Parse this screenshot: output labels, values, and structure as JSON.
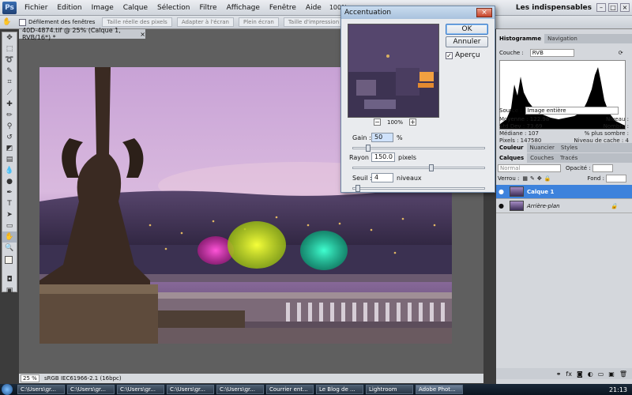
{
  "menubar": {
    "logo": "Ps",
    "items": [
      "Fichier",
      "Edition",
      "Image",
      "Calque",
      "Sélection",
      "Filtre",
      "Affichage",
      "Fenêtre",
      "Aide"
    ],
    "zoom_value": "100%",
    "workspace": "Les indispensables"
  },
  "optbar": {
    "scroll_all_label": "Défilement des fenêtres",
    "buttons": [
      "Taille réelle des pixels",
      "Adapter à l'écran",
      "Plein écran",
      "Taille d'impression"
    ]
  },
  "document": {
    "tab_title": "40D-4874.tif @ 25% (Calque 1, RVB/16*) *",
    "zoom": "25 %",
    "profile": "sRGB IEC61966-2.1 (16bpc)"
  },
  "dialog": {
    "title": "Accentuation",
    "ok": "OK",
    "cancel": "Annuler",
    "preview_label": "Aperçu",
    "preview_checked": true,
    "zoom": "100%",
    "gain_label": "Gain :",
    "gain_value": "50",
    "gain_unit": "%",
    "gain_level": 0.1,
    "rayon_label": "Rayon :",
    "rayon_value": "150.0",
    "rayon_unit": "pixels",
    "rayon_level": 0.6,
    "seuil_label": "Seuil :",
    "seuil_value": "4",
    "seuil_unit": "niveaux",
    "seuil_level": 0.02
  },
  "panels": {
    "top_tabs": [
      "Histogramme",
      "Navigation"
    ],
    "couche_label": "Couche :",
    "couche_value": "RVB",
    "source_label": "Source :",
    "source_value": "Image entière",
    "stats_left": [
      {
        "label": "Moyenne :",
        "value": "122.98"
      },
      {
        "label": "Std Dev :",
        "value": "73.69"
      },
      {
        "label": "Médiane :",
        "value": "107"
      },
      {
        "label": "Pixels :",
        "value": "147580"
      }
    ],
    "stats_right": [
      {
        "label": "Niveau :",
        "value": ""
      },
      {
        "label": "Nombre :",
        "value": ""
      },
      {
        "label": "% plus sombre :",
        "value": ""
      },
      {
        "label": "Niveau de cache :",
        "value": "4"
      }
    ],
    "color_tabs": [
      "Couleur",
      "Nuancier",
      "Styles"
    ],
    "layer_tabs": [
      "Calques",
      "Couches",
      "Tracés"
    ],
    "blend_mode": "Normal",
    "opacity_label": "Opacité :",
    "lock_label": "Verrou :",
    "fill_label": "Fond :",
    "layers": [
      "Calque 1",
      "Arrière-plan"
    ]
  },
  "taskbar": {
    "items": [
      "C:\\Users\\gr...",
      "C:\\Users\\gr...",
      "C:\\Users\\gr...",
      "C:\\Users\\gr...",
      "C:\\Users\\gr...",
      "Courrier ent...",
      "Le Blog de ...",
      "Lightroom",
      "Adobe Phot..."
    ],
    "clock": "21:13"
  }
}
